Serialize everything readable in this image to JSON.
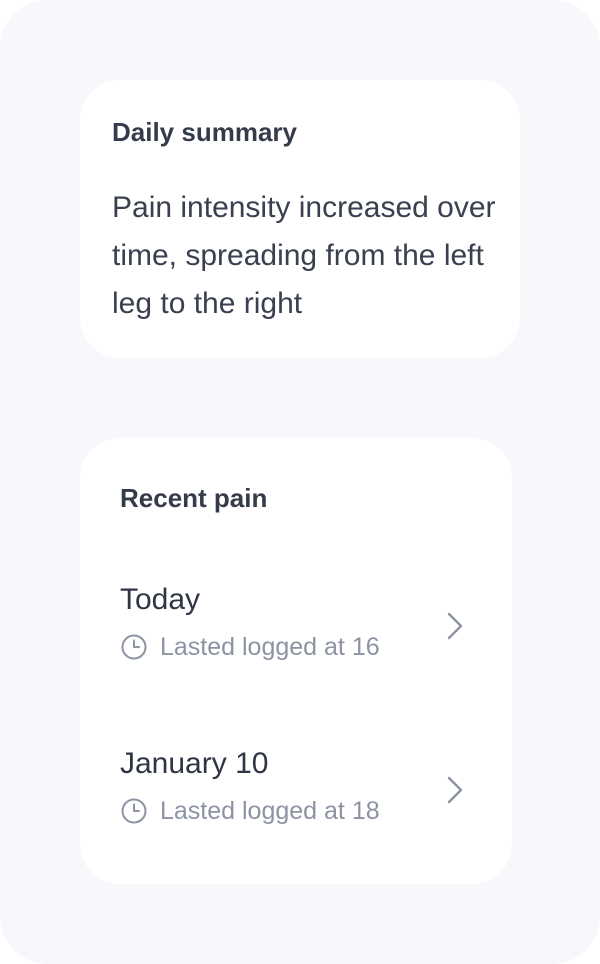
{
  "summary": {
    "title": "Daily summary",
    "text": "Pain intensity increased over time, spreading from the left leg to the right"
  },
  "recent": {
    "title": "Recent pain",
    "entries": [
      {
        "date": "Today",
        "log": "Lasted logged at 16"
      },
      {
        "date": "January 10",
        "log": "Lasted logged at 18"
      }
    ]
  },
  "icons": {
    "clock": "clock-icon",
    "chevron": "chevron-right-icon"
  },
  "colors": {
    "background": "#f7f8fc",
    "card": "#ffffff",
    "primary_text": "#2f3545",
    "secondary_text": "#8c93a3"
  }
}
